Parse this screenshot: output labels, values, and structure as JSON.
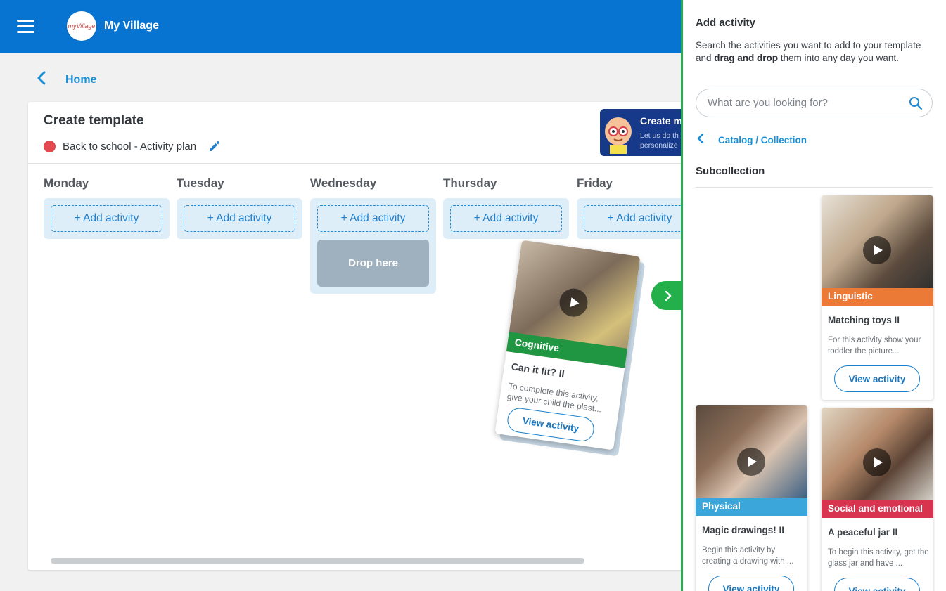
{
  "header": {
    "app_title": "My Village",
    "logo_text": "myVillage"
  },
  "nav": {
    "back_label": "Home"
  },
  "template": {
    "title": "Create template",
    "plan_name": "Back to school - Activity plan",
    "status_color": "#e3494f"
  },
  "banner": {
    "title": "Create m",
    "line1": "Let us do th",
    "line2": "personalize"
  },
  "days": [
    {
      "name": "Monday",
      "add_label": "+ Add activity"
    },
    {
      "name": "Tuesday",
      "add_label": "+ Add activity"
    },
    {
      "name": "Wednesday",
      "add_label": "+ Add activity",
      "drop_label": "Drop here"
    },
    {
      "name": "Thursday",
      "add_label": "+ Add activity"
    },
    {
      "name": "Friday",
      "add_label": "+ Add activity"
    }
  ],
  "dragging": {
    "tag": "Cognitive",
    "tag_color": "#219642",
    "title": "Can it fit? II",
    "description": "To complete this activity, give your child the plast...",
    "button": "View activity"
  },
  "panel": {
    "title": "Add activity",
    "desc_part1": "Search the activities you want to add to your template and ",
    "desc_bold": "drag and drop",
    "desc_part2": " them into any day you want.",
    "search_placeholder": "What are you looking for?",
    "breadcrumb": "Catalog / Collection",
    "subcollection": "Subcollection",
    "activities": [
      {
        "tag": "Linguistic",
        "tag_color": "#ec7a37",
        "title": "Matching toys II",
        "description": "For this activity show your toddler the picture...",
        "button": "View activity"
      },
      {
        "tag": "Physical",
        "tag_color": "#3ba6d9",
        "title": "Magic drawings! II",
        "description": "Begin this activity by creating a drawing with ...",
        "button": "View activity"
      },
      {
        "tag": "Social and emotional",
        "tag_color": "#d8344f",
        "title": "A peaceful jar II",
        "description": "To begin this activity, get the glass jar and have ...",
        "button": "View activity"
      }
    ]
  }
}
